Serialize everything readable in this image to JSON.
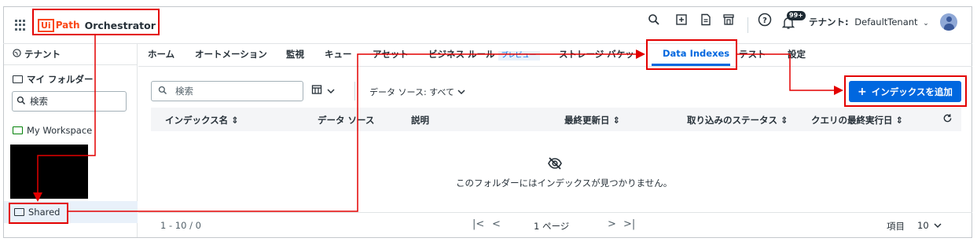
{
  "header": {
    "logo_box": "Ui",
    "logo_path": "Path",
    "app_name": "Orchestrator",
    "notification_badge": "99+",
    "tenant_label": "テナント:",
    "tenant_name": "DefaultTenant"
  },
  "sidebar": {
    "tenant_label": "テナント",
    "my_folder_label": "マイ フォルダー",
    "search_placeholder": "検索",
    "workspace_label": "My Workspace",
    "shared_label": "Shared"
  },
  "tabs": [
    {
      "label": "ホーム"
    },
    {
      "label": "オートメーション"
    },
    {
      "label": "監視"
    },
    {
      "label": "キュー"
    },
    {
      "label": "アセット"
    },
    {
      "label": "ビジネス ルール"
    },
    {
      "label": "ストレージ バケット"
    },
    {
      "label": "Data Indexes"
    },
    {
      "label": "テスト"
    },
    {
      "label": "設定"
    }
  ],
  "preview_chip": "プレビュー",
  "toolbar": {
    "search_placeholder": "検索",
    "datasource_filter": "データ ソース: すべて",
    "add_button": "インデックスを追加"
  },
  "table": {
    "columns": [
      "インデックス名 ⇕",
      "データ ソース",
      "説明",
      "最終更新日 ⇕",
      "取り込みのステータス ⇕",
      "クエリの最終実行日 ⇕"
    ],
    "empty_message": "このフォルダーにはインデックスが見つかりません。"
  },
  "footer": {
    "range": "1 - 10 / 0",
    "page": "1 ページ",
    "items_label": "項目",
    "page_size": "10"
  },
  "colors": {
    "accent": "#0067df",
    "annotation": "#e30000",
    "brand": "#fa4616"
  }
}
